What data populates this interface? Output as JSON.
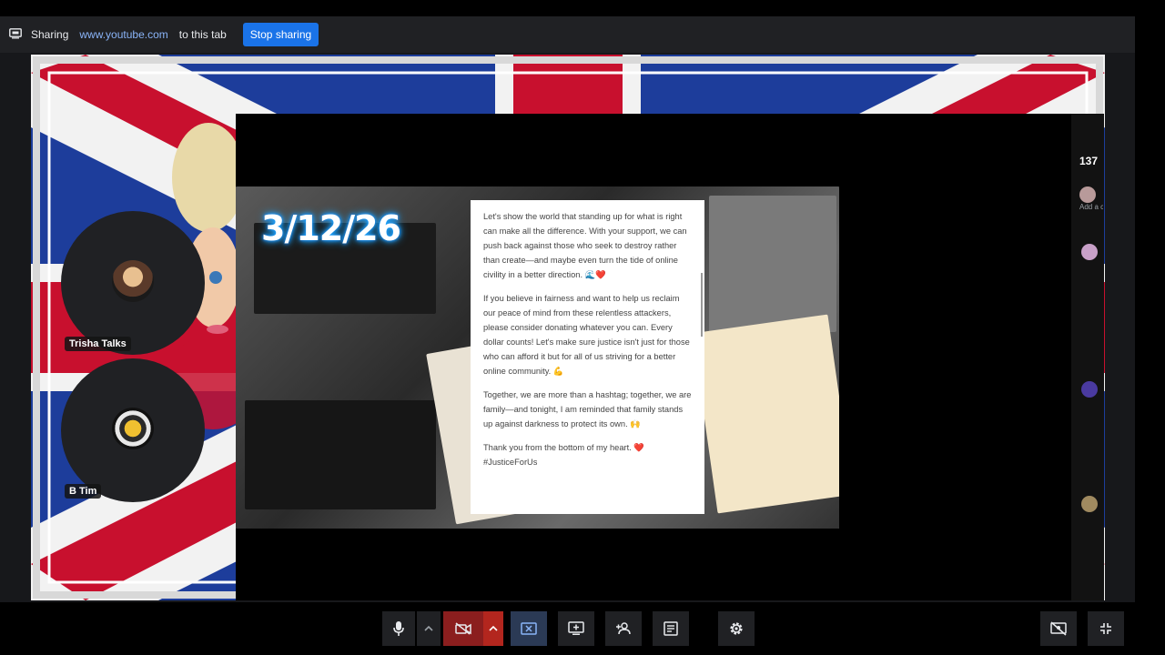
{
  "share_bar": {
    "sharing_label": "Sharing",
    "shared_url": "www.youtube.com",
    "tail_text": "to this tab",
    "stop_button": "Stop sharing"
  },
  "video": {
    "date_overlay": "3/12/26",
    "post_paragraphs": [
      "Let's show the world that standing up for what is right can make all the difference. With your support, we can push back against those who seek to destroy rather than create—and maybe even turn the tide of online civility in a better direction. 🌊❤️",
      "If you believe in fairness and want to help us reclaim our peace of mind from these relentless attackers, please consider donating whatever you can. Every dollar counts! Let's make sure justice isn't just for those who can afford it but for all of us striving for a better online community. 💪",
      "Together, we are more than a hashtag; together, we are family—and tonight, I am reminded that family stands up against darkness to protect its own. 🙌",
      "Thank you from the bottom of my heart. ❤️ #JusticeForUs"
    ]
  },
  "chat": {
    "count": "137",
    "add_comment": "Add a comm"
  },
  "participants": [
    {
      "name": "Trisha Talks"
    },
    {
      "name": "B Tim"
    }
  ],
  "colors": {
    "stop_button": "#1a73e8",
    "link": "#8ab4f8",
    "camera_off": "#8b1e1e",
    "date_glow": "#1ea7ff"
  },
  "controls": {
    "icons": [
      "mic-icon",
      "chevron-up-icon",
      "camera-off-icon",
      "chevron-up-icon",
      "stop-present-icon",
      "present-icon",
      "add-person-icon",
      "captions-icon",
      "settings-icon",
      "hide-self-icon",
      "exit-fullscreen-icon"
    ]
  }
}
